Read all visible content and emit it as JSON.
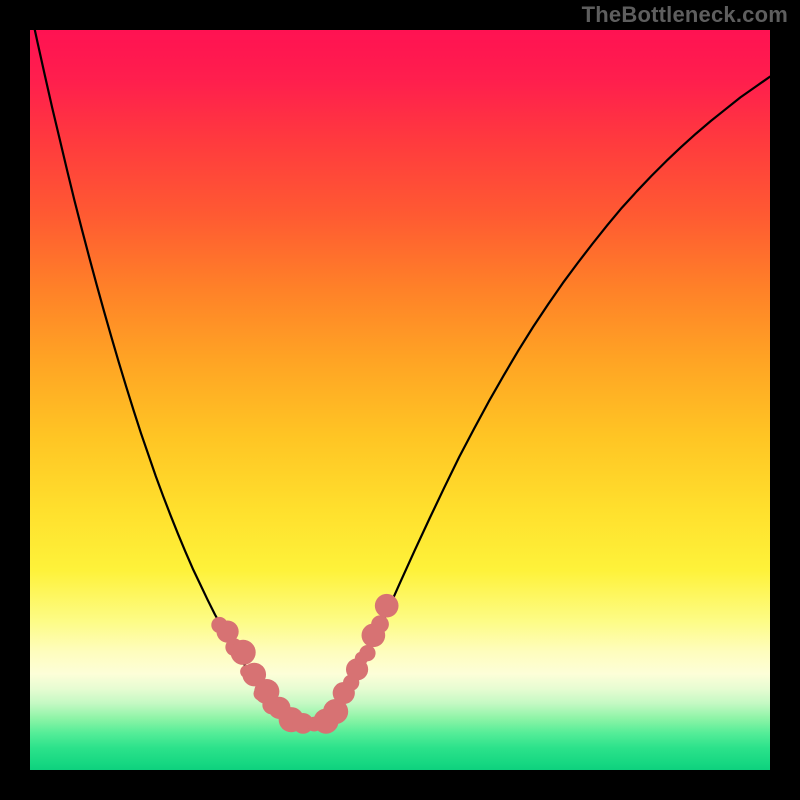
{
  "domain": "Chart",
  "watermark": "TheBottleneck.com",
  "colors": {
    "frame": "#000000",
    "curve": "#000000",
    "dots": "#d77273",
    "gradient_top": "#ff1252",
    "gradient_mid": "#ffc524",
    "gradient_bottom": "#0ed17e"
  },
  "chart_data": {
    "type": "line",
    "title": "",
    "xlabel": "",
    "ylabel": "",
    "xlim": [
      0,
      100
    ],
    "ylim": [
      0,
      100
    ],
    "x": [
      0,
      1,
      2,
      3,
      4,
      5,
      6,
      7,
      8,
      9,
      10,
      11,
      12,
      13,
      14,
      15,
      16,
      17,
      18,
      19,
      20,
      21,
      22,
      23,
      24,
      25,
      26,
      27,
      28,
      29,
      30,
      31,
      32,
      33,
      34,
      35,
      36,
      38,
      40,
      42,
      44,
      46,
      48,
      50,
      52,
      54,
      56,
      58,
      60,
      62,
      64,
      66,
      68,
      70,
      72,
      74,
      76,
      78,
      80,
      82,
      84,
      86,
      88,
      90,
      92,
      94,
      96,
      98,
      100
    ],
    "y": [
      103.0,
      98.4,
      93.9,
      89.5,
      85.3,
      81.1,
      77.0,
      73.1,
      69.3,
      65.6,
      62.0,
      58.5,
      55.1,
      51.8,
      48.6,
      45.5,
      42.6,
      39.7,
      37.0,
      34.4,
      31.9,
      29.5,
      27.2,
      25.1,
      23.0,
      21.0,
      19.2,
      17.4,
      15.8,
      14.2,
      12.8,
      11.4,
      10.2,
      9.1,
      8.0,
      7.2,
      6.7,
      6.2,
      6.8,
      9.0,
      12.4,
      16.4,
      20.8,
      25.3,
      29.7,
      34.0,
      38.2,
      42.3,
      46.1,
      49.8,
      53.3,
      56.7,
      59.9,
      62.9,
      65.8,
      68.5,
      71.1,
      73.6,
      76.0,
      78.2,
      80.3,
      82.3,
      84.2,
      86.0,
      87.7,
      89.3,
      90.9,
      92.3,
      93.7
    ],
    "marker_points": [
      {
        "x": 25.6,
        "y": 19.6,
        "r": 1.1
      },
      {
        "x": 26.7,
        "y": 18.7,
        "r": 1.5
      },
      {
        "x": 27.6,
        "y": 16.6,
        "r": 1.2
      },
      {
        "x": 28.8,
        "y": 15.9,
        "r": 1.7
      },
      {
        "x": 29.3,
        "y": 13.3,
        "r": 0.9
      },
      {
        "x": 30.3,
        "y": 12.9,
        "r": 1.6
      },
      {
        "x": 31.1,
        "y": 10.3,
        "r": 0.9
      },
      {
        "x": 32.0,
        "y": 10.6,
        "r": 1.7
      },
      {
        "x": 32.7,
        "y": 8.8,
        "r": 1.3
      },
      {
        "x": 33.7,
        "y": 8.4,
        "r": 1.5
      },
      {
        "x": 35.3,
        "y": 6.8,
        "r": 1.7
      },
      {
        "x": 36.9,
        "y": 6.3,
        "r": 1.4
      },
      {
        "x": 38.4,
        "y": 6.2,
        "r": 1.0
      },
      {
        "x": 40.0,
        "y": 6.6,
        "r": 1.7
      },
      {
        "x": 41.3,
        "y": 7.9,
        "r": 1.7
      },
      {
        "x": 42.4,
        "y": 10.4,
        "r": 1.5
      },
      {
        "x": 43.4,
        "y": 11.8,
        "r": 1.1
      },
      {
        "x": 44.2,
        "y": 13.6,
        "r": 1.5
      },
      {
        "x": 44.8,
        "y": 15.1,
        "r": 0.9
      },
      {
        "x": 45.6,
        "y": 15.8,
        "r": 1.1
      },
      {
        "x": 46.4,
        "y": 18.2,
        "r": 1.6
      },
      {
        "x": 47.3,
        "y": 19.7,
        "r": 1.2
      },
      {
        "x": 48.2,
        "y": 22.2,
        "r": 1.6
      }
    ],
    "legend": null,
    "grid": false
  }
}
